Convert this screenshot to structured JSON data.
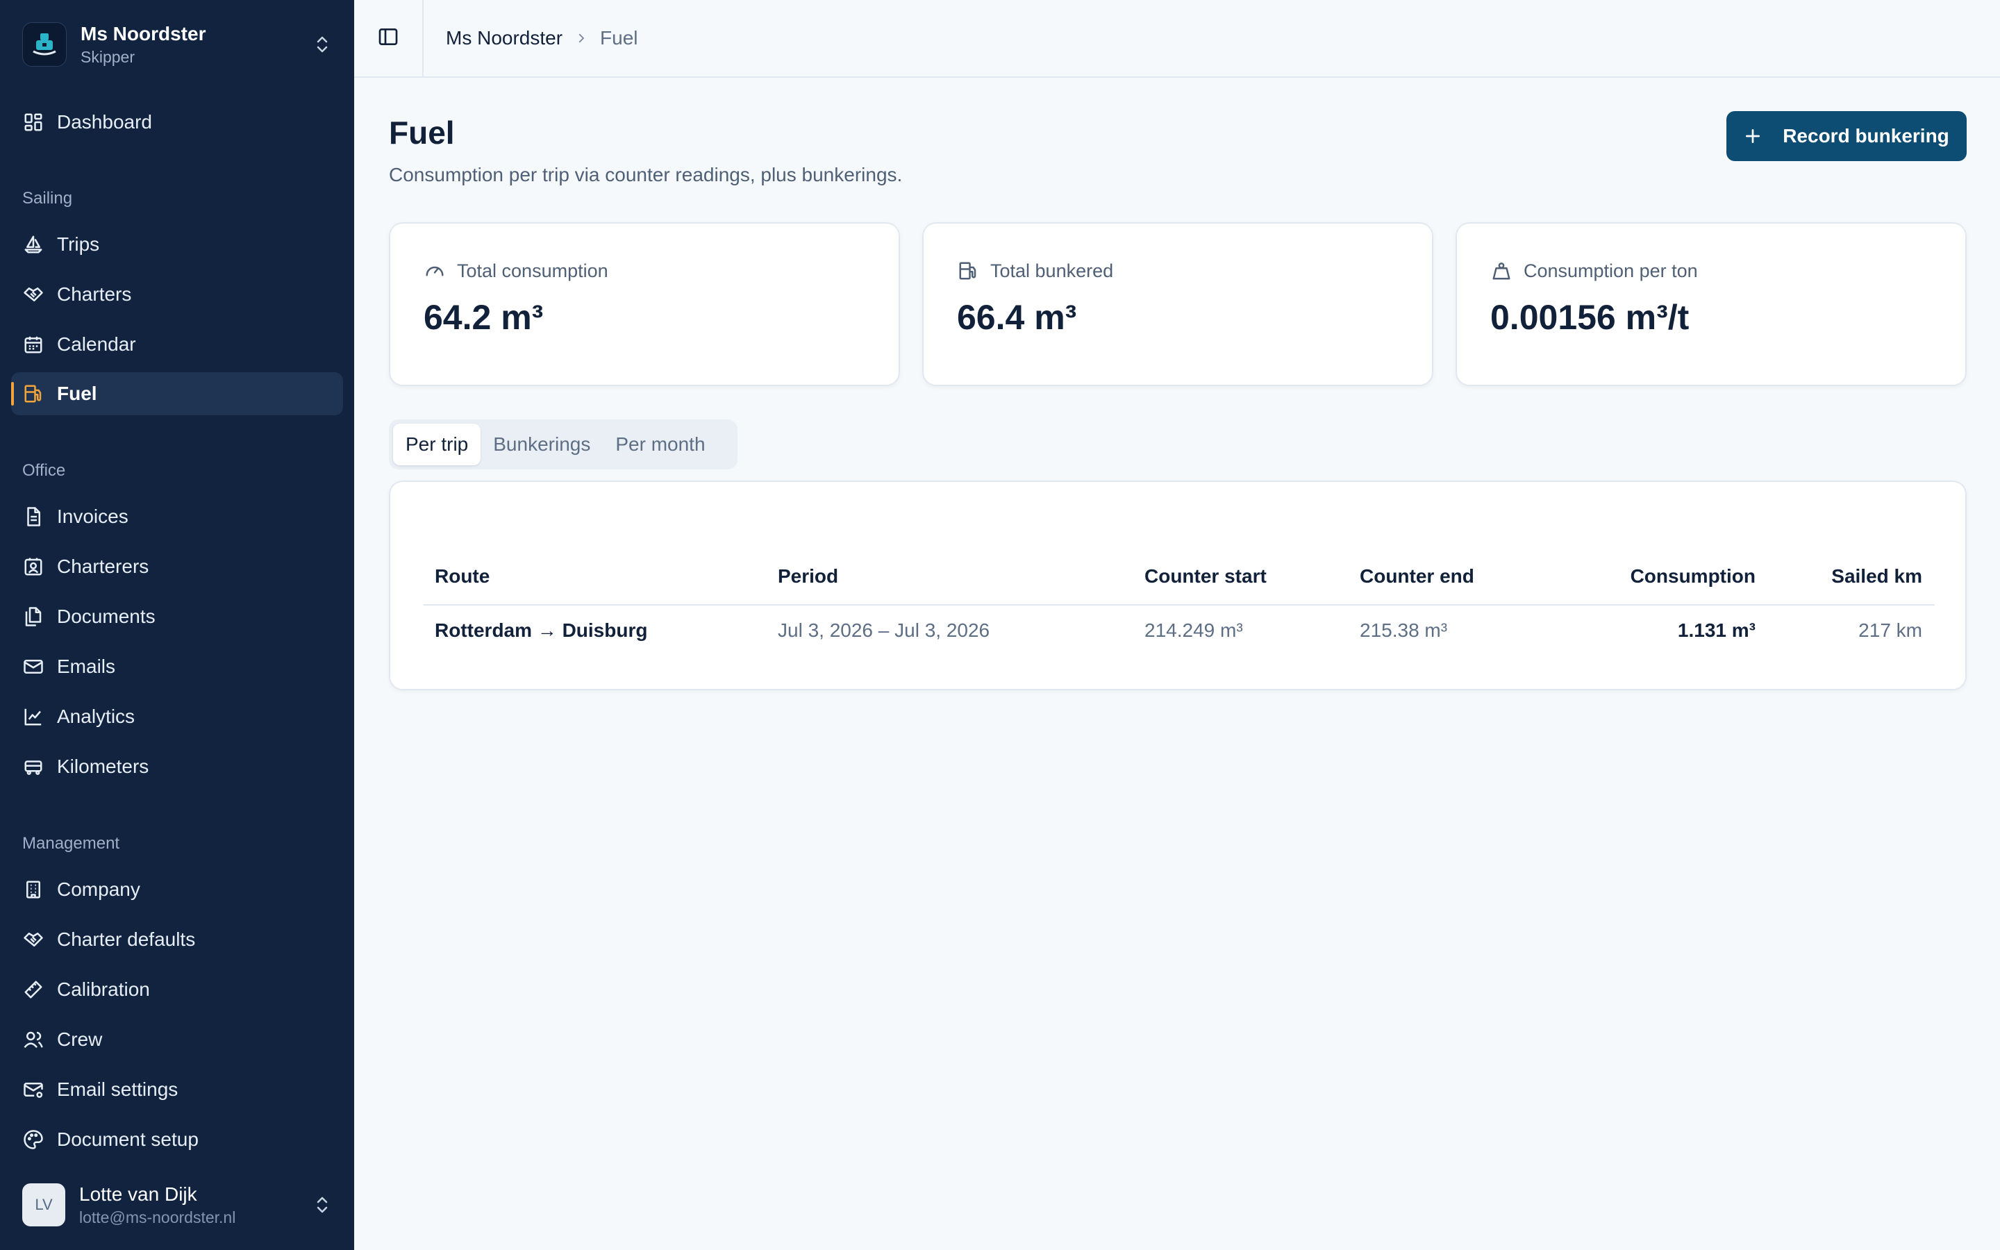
{
  "workspace": {
    "name": "Ms Noordster",
    "role": "Skipper"
  },
  "nav": {
    "dashboard": "Dashboard",
    "sailing_label": "Sailing",
    "trips": "Trips",
    "charters": "Charters",
    "calendar": "Calendar",
    "fuel": "Fuel",
    "office_label": "Office",
    "invoices": "Invoices",
    "charterers": "Charterers",
    "documents": "Documents",
    "emails": "Emails",
    "analytics": "Analytics",
    "kilometers": "Kilometers",
    "management_label": "Management",
    "company": "Company",
    "charter_defaults": "Charter defaults",
    "calibration": "Calibration",
    "crew": "Crew",
    "email_settings": "Email settings",
    "document_setup": "Document setup"
  },
  "user": {
    "initials": "LV",
    "name": "Lotte van Dijk",
    "email": "lotte@ms-noordster.nl"
  },
  "breadcrumb": {
    "root": "Ms Noordster",
    "current": "Fuel"
  },
  "page": {
    "title": "Fuel",
    "subtitle": "Consumption per trip via counter readings, plus bunkerings.",
    "record_button": "Record bunkering"
  },
  "stats": {
    "total_consumption": {
      "label": "Total consumption",
      "value": "64.2 m³"
    },
    "total_bunkered": {
      "label": "Total bunkered",
      "value": "66.4 m³"
    },
    "per_ton": {
      "label": "Consumption per ton",
      "value": "0.00156 m³/t"
    }
  },
  "tabs": {
    "per_trip": "Per trip",
    "bunkerings": "Bunkerings",
    "per_month": "Per month"
  },
  "table": {
    "headers": {
      "route": "Route",
      "period": "Period",
      "counter_start": "Counter start",
      "counter_end": "Counter end",
      "consumption": "Consumption",
      "sailed_km": "Sailed km"
    },
    "rows": [
      {
        "route": "Rotterdam → Duisburg",
        "period": "Jul 3, 2026 – Jul 3, 2026",
        "counter_start": "214.249 m³",
        "counter_end": "215.38 m³",
        "consumption": "1.131 m³",
        "sailed_km": "217 km"
      }
    ]
  },
  "colors": {
    "sidebar_bg": "#11233f",
    "active_item_bg": "#1f3453",
    "active_accent": "#f3a43a",
    "primary_button": "#0d4d73",
    "page_bg": "#f6f9fb"
  }
}
